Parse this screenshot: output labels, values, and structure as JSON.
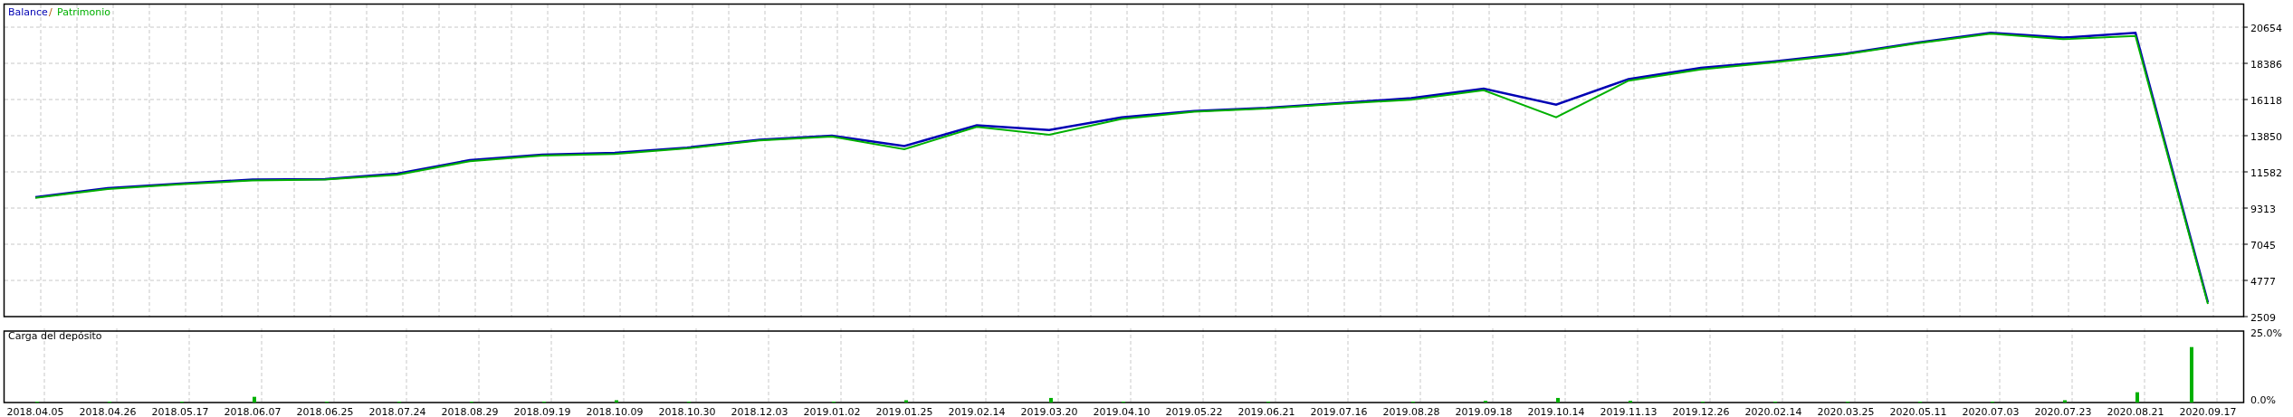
{
  "charts": [
    {
      "legend_separator": "/",
      "chart_data": {
        "type": "line",
        "grid": true,
        "ylim": [
          2509,
          22102
        ],
        "series": [
          {
            "name": "Balance",
            "color": "#0000b4",
            "values": [
              10000,
              10560,
              10840,
              11100,
              11130,
              11470,
              12320,
              12660,
              12770,
              13100,
              13600,
              13850,
              13200,
              14500,
              14200,
              15000,
              15400,
              15600,
              15900,
              16200,
              16800,
              15800,
              17400,
              18100,
              18500,
              19000,
              19700,
              20300,
              20000,
              20300,
              3400
            ]
          },
          {
            "name": "Patrimonio",
            "color": "#00b000",
            "values": [
              9950,
              10500,
              10800,
              11050,
              11100,
              11400,
              12250,
              12600,
              12700,
              13050,
              13550,
              13800,
              13000,
              14400,
              13900,
              14900,
              15350,
              15550,
              15850,
              16100,
              16700,
              15000,
              17300,
              18000,
              18450,
              18950,
              19650,
              20250,
              19900,
              20100,
              3300
            ]
          }
        ],
        "yticks": [
          2509,
          4777,
          7045,
          9313,
          11582,
          13850,
          16118,
          18386,
          20654
        ]
      }
    },
    {
      "title": "Carga del depósito",
      "chart_data": {
        "type": "bar",
        "grid": true,
        "ylim": [
          0,
          25
        ],
        "categories": [
          "2018.04.05",
          "2018.04.26",
          "2018.05.17",
          "2018.06.07",
          "2018.06.25",
          "2018.07.24",
          "2018.08.29",
          "2018.09.19",
          "2018.10.09",
          "2018.10.30",
          "2018.12.03",
          "2019.01.02",
          "2019.01.25",
          "2019.02.14",
          "2019.03.20",
          "2019.04.10",
          "2019.05.22",
          "2019.06.21",
          "2019.07.16",
          "2019.08.28",
          "2019.09.18",
          "2019.10.14",
          "2019.11.13",
          "2019.12.26",
          "2020.02.14",
          "2020.03.25",
          "2020.05.11",
          "2020.07.03",
          "2020.07.23",
          "2020.08.21",
          "2020.09.17"
        ],
        "values": [
          0.3,
          0.3,
          0.3,
          2.0,
          0.3,
          0.3,
          0.3,
          0.3,
          0.8,
          0.3,
          0,
          0.3,
          0.8,
          0,
          1.6,
          0.3,
          0,
          0.3,
          0,
          0.3,
          0.6,
          1.6,
          0.6,
          0.3,
          0.3,
          0.3,
          0.3,
          0.3,
          0.8,
          3.6,
          19.4
        ],
        "color": "#00b000",
        "yticks": [
          {
            "value": 0,
            "label": "0.0%"
          },
          {
            "value": 25,
            "label": "25.0%"
          }
        ]
      }
    }
  ]
}
